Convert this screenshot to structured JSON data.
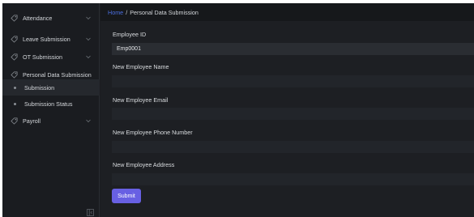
{
  "sidebar": {
    "items": [
      {
        "label": "Attendance",
        "icon": "tag-icon",
        "has_chevron": true
      },
      {
        "label": "Leave Submission",
        "icon": "tag-icon",
        "has_chevron": true
      },
      {
        "label": "OT Submission",
        "icon": "tag-icon",
        "has_chevron": true
      },
      {
        "label": "Personal Data Submission",
        "icon": "tag-icon",
        "has_chevron": false
      },
      {
        "label": "Submission",
        "icon": "dot",
        "active": true
      },
      {
        "label": "Submission Status",
        "icon": "dot",
        "active": false
      },
      {
        "label": "Payroll",
        "icon": "tag-icon",
        "has_chevron": true
      }
    ],
    "collapse_icon": "sidebar-collapse-icon"
  },
  "breadcrumb": {
    "home": "Home",
    "separator": "/",
    "current": "Personal Data Submission"
  },
  "form": {
    "employee_id_label": "Employee ID",
    "employee_id_value": "Emp0001",
    "name_label": "New Employee Name",
    "name_value": "",
    "email_label": "New Employee Email",
    "email_value": "",
    "phone_label": "New Employee Phone Number",
    "phone_value": "",
    "address_label": "New Employee Address",
    "address_value": "",
    "submit_label": "Submit"
  },
  "colors": {
    "accent": "#6860e3",
    "link": "#4a6ee0",
    "sidebar_bg": "#1a1c20",
    "main_bg": "#1d1f23"
  }
}
